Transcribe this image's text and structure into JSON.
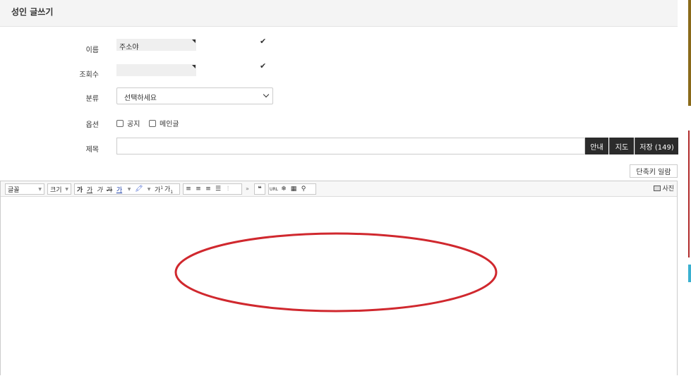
{
  "header": {
    "title": "성인 글쓰기"
  },
  "form": {
    "name_label": "이름",
    "name_value": "주소야",
    "views_label": "조회수",
    "views_value": "",
    "category_label": "분류",
    "category_selected": "선택하세요",
    "options_label": "옵션",
    "option_notice": "공지",
    "option_main": "메인글",
    "subject_label": "제목",
    "subject_value": "",
    "btn_guide": "안내",
    "btn_map": "지도",
    "btn_save": "저장 (149)",
    "btn_shortcuts": "단축키 일람"
  },
  "editor": {
    "font_label": "글꼴",
    "size_label": "크기",
    "format_buttons": [
      "가",
      "가",
      "가",
      "가",
      "가",
      "가",
      "가",
      "가"
    ],
    "photo_label": "사진"
  },
  "colors": {
    "dark_button": "#2b2b2b",
    "annotation_ellipse": "#d0282e",
    "header_bg": "#f4f4f4"
  }
}
